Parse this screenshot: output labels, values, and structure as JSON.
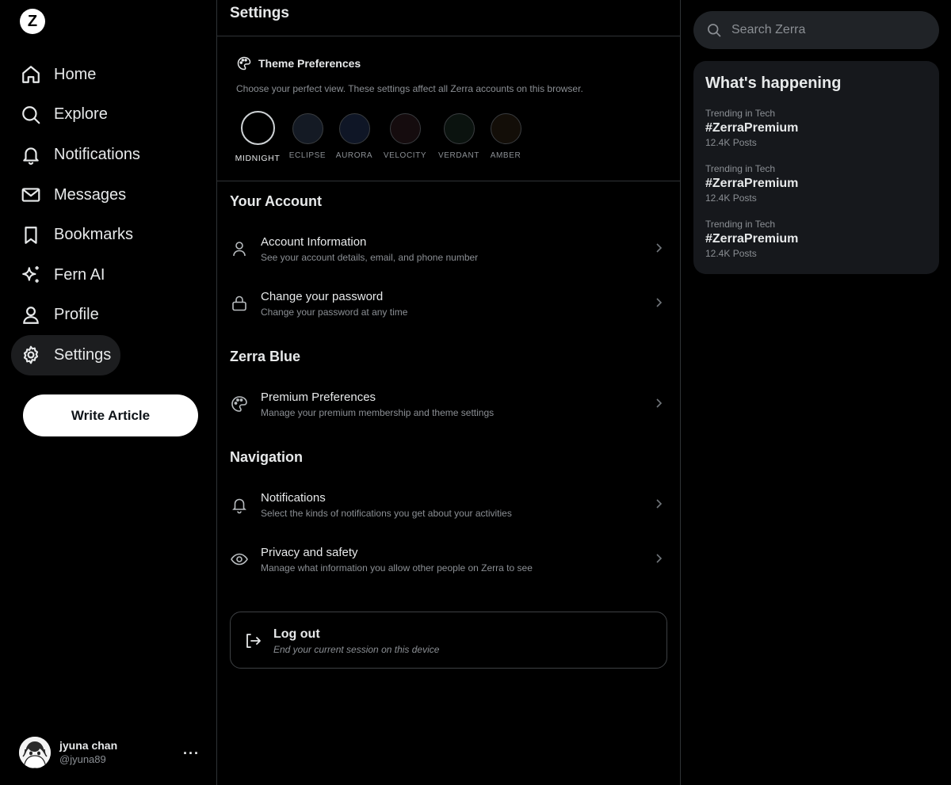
{
  "sidebar": {
    "logo": "Z",
    "nav": [
      {
        "label": "Home",
        "icon": "home-icon"
      },
      {
        "label": "Explore",
        "icon": "search-icon"
      },
      {
        "label": "Notifications",
        "icon": "bell-icon"
      },
      {
        "label": "Messages",
        "icon": "mail-icon"
      },
      {
        "label": "Bookmarks",
        "icon": "bookmark-icon"
      },
      {
        "label": "Fern AI",
        "icon": "sparkle-icon"
      },
      {
        "label": "Profile",
        "icon": "user-icon"
      },
      {
        "label": "Settings",
        "icon": "gear-icon",
        "active": true
      }
    ],
    "write_button": "Write Article",
    "user": {
      "name": "jyuna chan",
      "handle": "@jyuna89",
      "more": "···"
    }
  },
  "main": {
    "title": "Settings",
    "theme": {
      "title": "Theme Preferences",
      "description": "Choose your perfect view. These settings affect all Zerra accounts on this browser.",
      "options": [
        {
          "label": "MIDNIGHT",
          "color": "#000000",
          "selected": true
        },
        {
          "label": "ECLIPSE",
          "color": "#141a24"
        },
        {
          "label": "AURORA",
          "color": "#0f1626"
        },
        {
          "label": "VELOCITY",
          "color": "#150c0e"
        },
        {
          "label": "VERDANT",
          "color": "#0b130f"
        },
        {
          "label": "AMBER",
          "color": "#130e08"
        }
      ]
    },
    "sections": [
      {
        "title": "Your Account",
        "rows": [
          {
            "title": "Account Information",
            "subtitle": "See your account details, email, and phone number",
            "icon": "user-icon"
          },
          {
            "title": "Change your password",
            "subtitle": "Change your password at any time",
            "icon": "lock-icon"
          }
        ]
      },
      {
        "title": "Zerra Blue",
        "rows": [
          {
            "title": "Premium Preferences",
            "subtitle": "Manage your premium membership and theme settings",
            "icon": "palette-icon"
          }
        ]
      },
      {
        "title": "Navigation",
        "rows": [
          {
            "title": "Notifications",
            "subtitle": "Select the kinds of notifications you get about your activities",
            "icon": "bell-icon"
          },
          {
            "title": "Privacy and safety",
            "subtitle": "Manage what information you allow other people on Zerra to see",
            "icon": "eye-icon"
          }
        ]
      }
    ],
    "logout": {
      "title": "Log out",
      "subtitle": "End your current session on this device"
    }
  },
  "right": {
    "search_placeholder": "Search Zerra",
    "happening_title": "What's happening",
    "trends": [
      {
        "category": "Trending in Tech",
        "tag": "#ZerraPremium",
        "count": "12.4K Posts"
      },
      {
        "category": "Trending in Tech",
        "tag": "#ZerraPremium",
        "count": "12.4K Posts"
      },
      {
        "category": "Trending in Tech",
        "tag": "#ZerraPremium",
        "count": "12.4K Posts"
      }
    ]
  }
}
